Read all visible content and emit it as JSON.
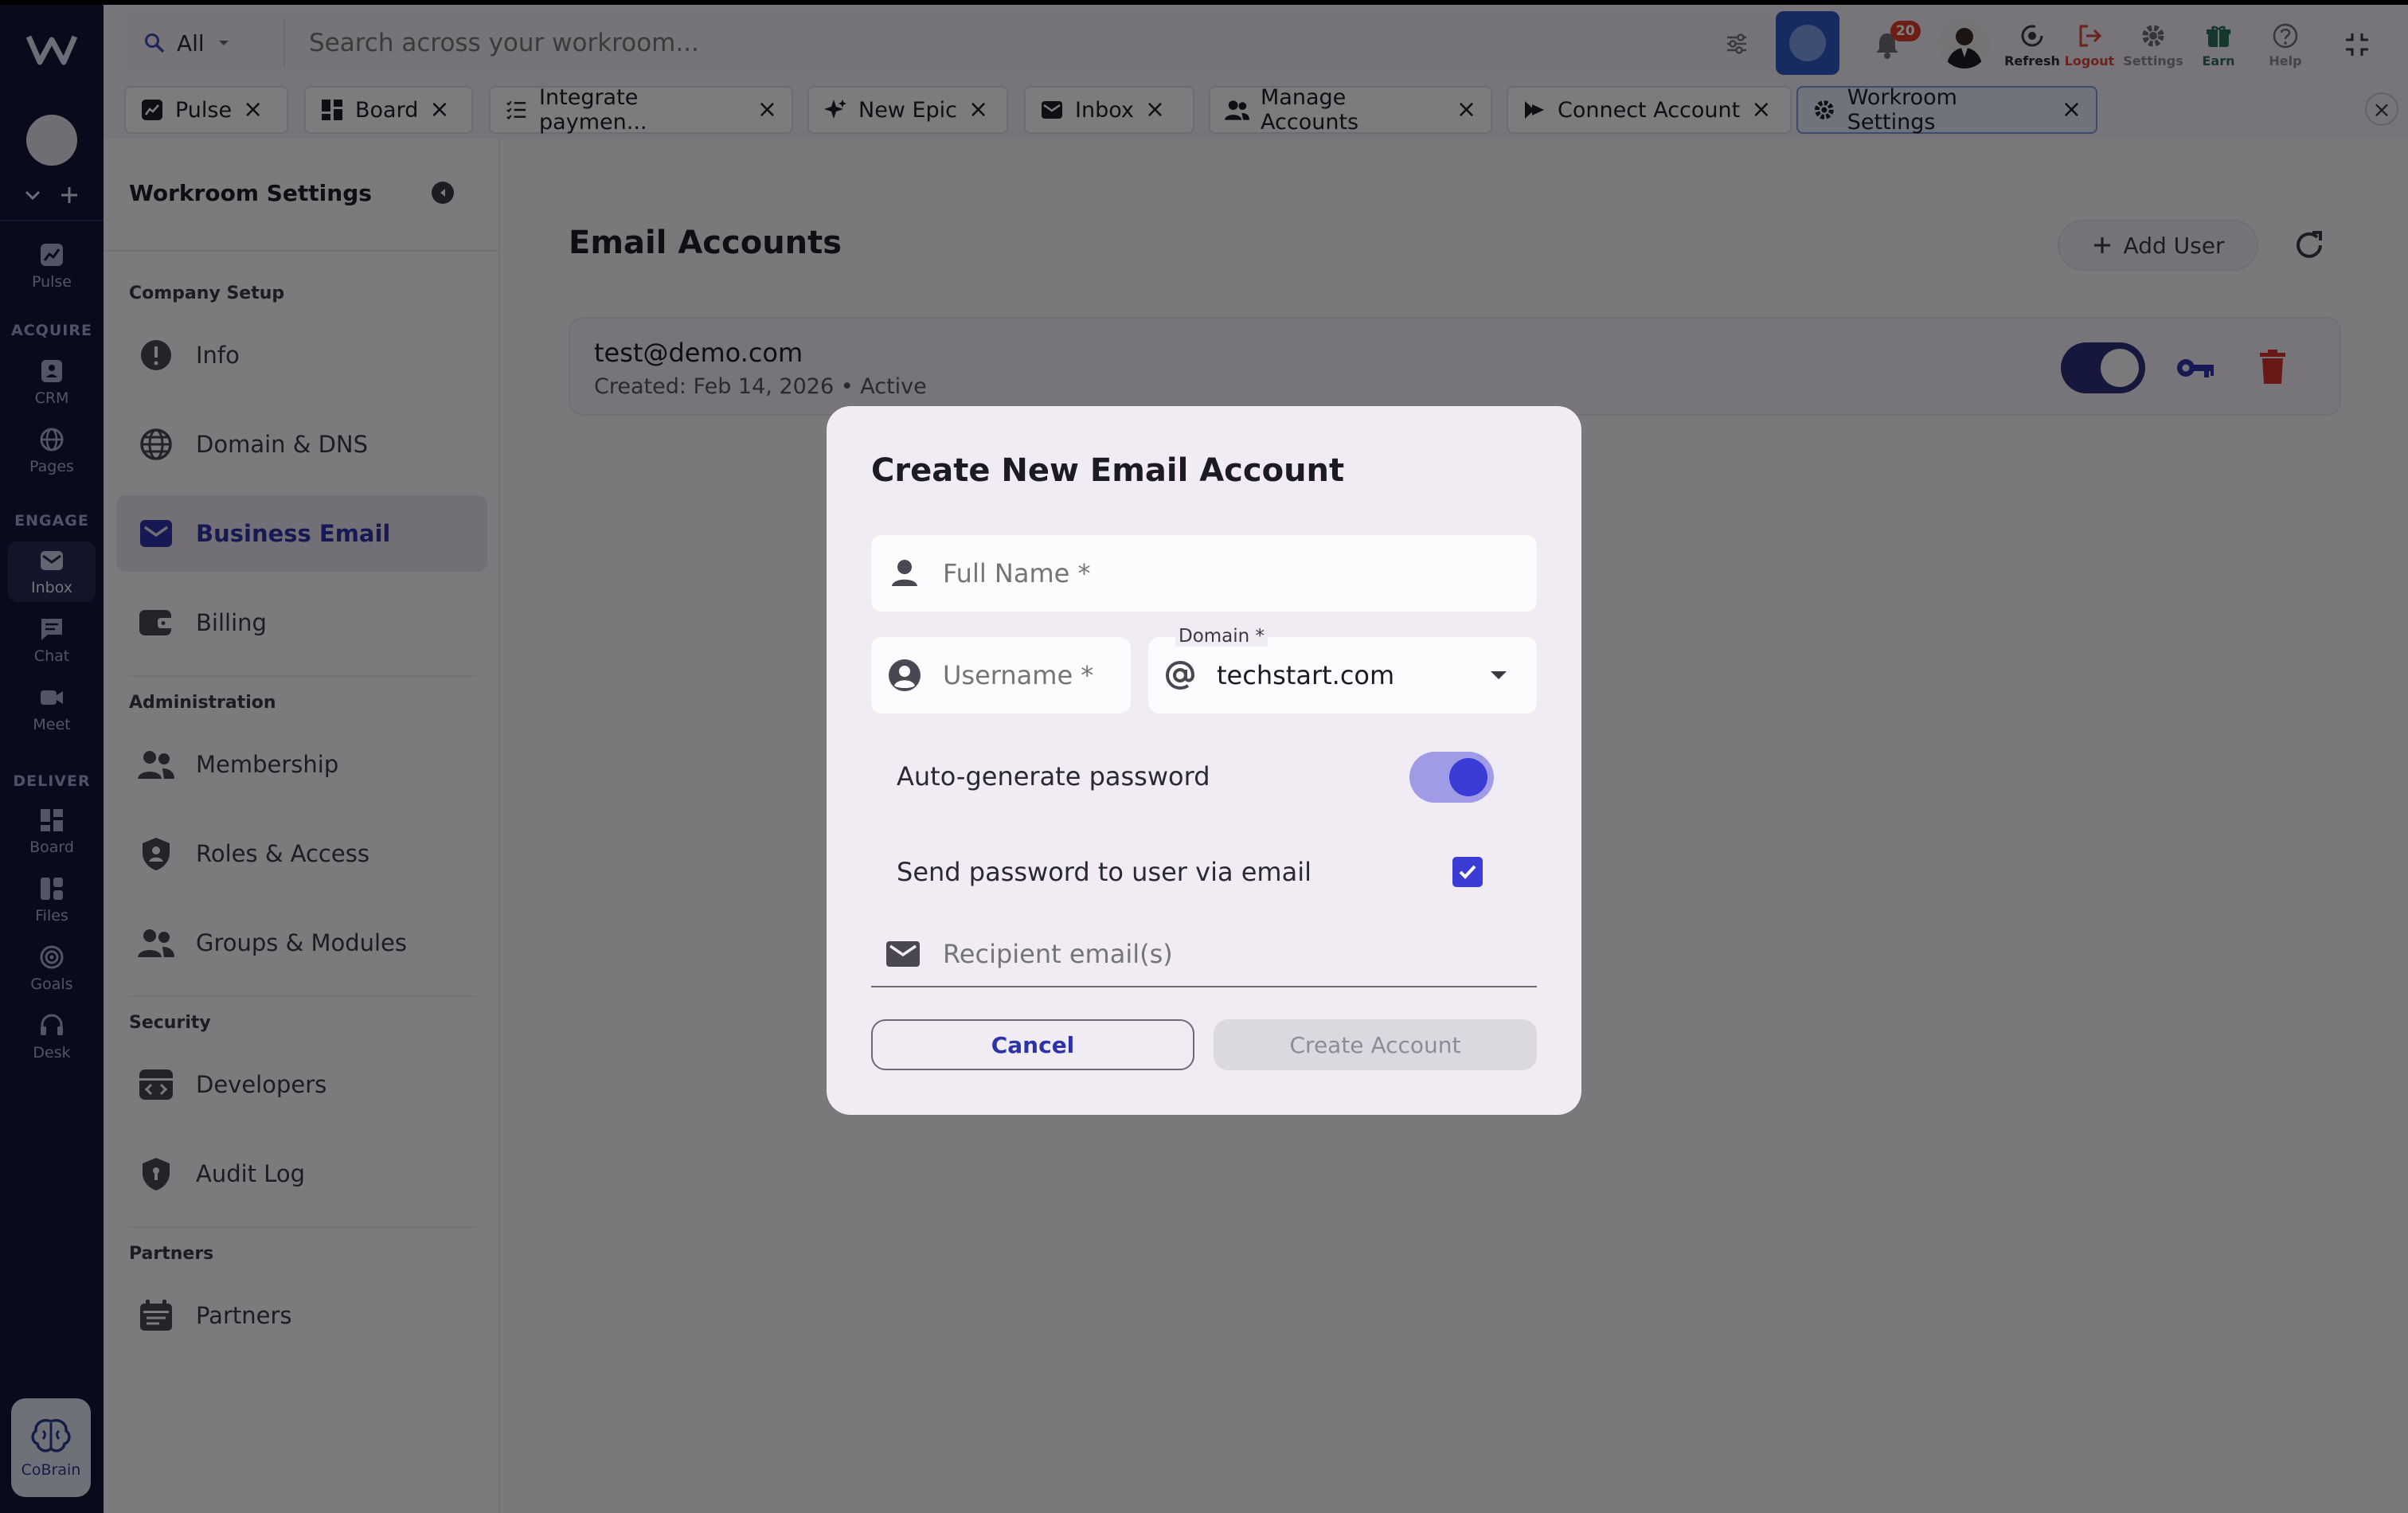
{
  "search": {
    "scope": "All",
    "placeholder": "Search across your workroom..."
  },
  "notifications": {
    "count": "20"
  },
  "header_actions": {
    "refresh": "Refresh",
    "logout": "Logout",
    "settings": "Settings",
    "earn": "Earn",
    "help": "Help"
  },
  "tabs": [
    {
      "label": "Pulse"
    },
    {
      "label": "Board"
    },
    {
      "label": "Integrate paymen..."
    },
    {
      "label": "New Epic"
    },
    {
      "label": "Inbox"
    },
    {
      "label": "Manage Accounts"
    },
    {
      "label": "Connect Account"
    },
    {
      "label": "Workroom Settings"
    }
  ],
  "rail": {
    "sections": {
      "acquire": "ACQUIRE",
      "engage": "ENGAGE",
      "deliver": "DELIVER"
    },
    "items": {
      "pulse": "Pulse",
      "crm": "CRM",
      "pages": "Pages",
      "inbox": "Inbox",
      "chat": "Chat",
      "meet": "Meet",
      "board": "Board",
      "files": "Files",
      "goals": "Goals",
      "desk": "Desk",
      "cobrain": "CoBrain"
    }
  },
  "sidebar": {
    "title": "Workroom Settings",
    "sections": {
      "company": "Company Setup",
      "admin": "Administration",
      "security": "Security",
      "partners": "Partners"
    },
    "items": {
      "info": "Info",
      "domain": "Domain & DNS",
      "email": "Business Email",
      "billing": "Billing",
      "membership": "Membership",
      "roles": "Roles & Access",
      "groups": "Groups & Modules",
      "developers": "Developers",
      "audit": "Audit Log",
      "partners": "Partners"
    }
  },
  "main": {
    "title": "Email Accounts",
    "add_user": "Add User",
    "account": {
      "email": "test@demo.com",
      "meta": "Created: Feb 14, 2026 • Active",
      "enabled": true
    }
  },
  "dialog": {
    "title": "Create New Email Account",
    "full_name_placeholder": "Full Name *",
    "username_placeholder": "Username *",
    "domain_label": "Domain *",
    "domain_value": "techstart.com",
    "autogen_label": "Auto-generate password",
    "autogen_on": true,
    "send_label": "Send password to user via email",
    "send_checked": true,
    "recipient_placeholder": "Recipient email(s)",
    "cancel": "Cancel",
    "create": "Create Account"
  },
  "colors": {
    "accent": "#3b3bd6",
    "rail_bg": "#13163a",
    "danger": "#d32f2f",
    "tab_active": "#dfe6f7"
  }
}
